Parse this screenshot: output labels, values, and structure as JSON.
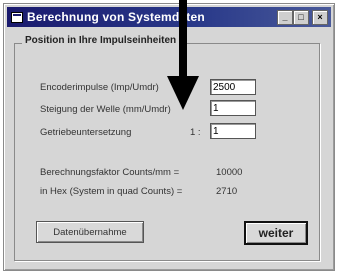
{
  "window": {
    "title": "Berechnung von Systemdaten"
  },
  "group": {
    "title": "Position in Ihre Impulseinheiten"
  },
  "rows": [
    {
      "label": "Encoderimpulse (Imp/Umdr)",
      "value": "2500"
    },
    {
      "label": "Steigung der Welle (mm/Umdr)",
      "value": "1"
    },
    {
      "label": "Getriebeuntersetzung",
      "prefix": "1 :",
      "value": "1"
    }
  ],
  "results": [
    {
      "label": "Berechnungsfaktor Counts/mm =",
      "value": "10000"
    },
    {
      "label": "in Hex (System in quad Counts) =",
      "value": "2710"
    }
  ],
  "buttons": {
    "apply": "Datenübernahme",
    "next": "weiter"
  }
}
